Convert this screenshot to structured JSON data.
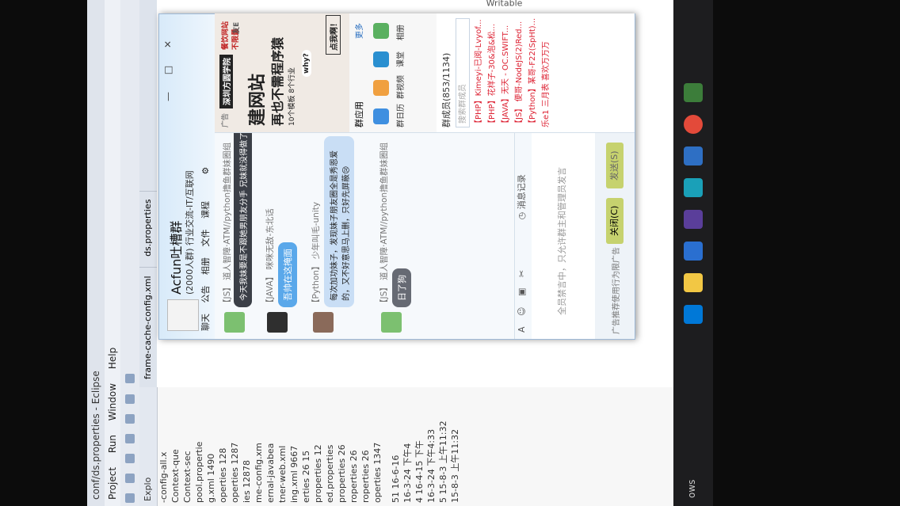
{
  "eclipse": {
    "title": "conf/ds.properties - Eclipse",
    "menu": [
      "Project",
      "Run",
      "Window",
      "Help"
    ],
    "explorer_tab": "Explo",
    "explorer_rows": [
      "-config-all.x",
      "Context-que",
      "Context-sec",
      "pool.propertie",
      "g.xml 1490",
      "operties 128",
      "operties 1287",
      "ies 12878",
      "me-config.xm",
      "ernal-javabea",
      "tner-web.xml",
      "ing.xml 9667",
      "erties 26 15",
      "properties 12",
      "ed.properties",
      "properties 26",
      "roperties 26",
      "roperties 26",
      "operties 1347"
    ],
    "editor_tabs": [
      "frame-cache-config.xml",
      "ds.properties"
    ],
    "history_rows": [
      "51 16-6-16",
      "16-3-24 下午4",
      "4 16-4-15 下午",
      "16-3-24 下午4:33",
      "5 15-8-3 上午11:32",
      "15-8-3 上午11:32"
    ],
    "side_label": "Writable",
    "taskbar_label": "ows"
  },
  "qq": {
    "group_name": "Acfun吐槽群",
    "group_sub": "(2000人群) 行业交流-IT/互联网",
    "win_buttons": [
      "—",
      "□",
      "✕"
    ],
    "tabs": [
      "聊天",
      "公告",
      "相册",
      "文件",
      "课程"
    ],
    "messages": [
      {
        "name": "【JS】 道人智障·ATM//python撸鱼群妹圈组",
        "text": "今天我妹要是不跟她男朋友分手 兄妹就没得做了",
        "style": "dark"
      },
      {
        "name": "【JAVA】 咪咪无敌-东北话",
        "text": "吾帅在这掩面",
        "style": "blue"
      },
      {
        "name": "【Python】 少年叫毛-unity",
        "text": "每次加功妹子，发现妹子朋友圈全是秀恩爱的，又不好意思马上删，只好先屏蔽😢",
        "style": "light"
      },
      {
        "name": "【JS】 道人智障·ATM//python撸鱼群妹圈组",
        "text": "日了狗",
        "style": "gray"
      }
    ],
    "history_link": "消息记录",
    "input_hint": "全员禁言中，只允许群主和管理员发言",
    "send_label": "发送(S)",
    "close_label": "关闭(C)",
    "footer_ad": "广告推荐使用行为限广告",
    "ad": {
      "tag": "广告",
      "brand": "深圳方圆学院",
      "line1": "建网站",
      "line2": "再也不需程序猿",
      "line3": "10个模板 8个行业",
      "cta": "点我啊！",
      "badge": "餐饮网站 不限量",
      "bubble": "why?",
      "logo": "友E"
    },
    "apps_title": "群应用",
    "apps_more": "更多",
    "apps": [
      "群日历",
      "群视频",
      "课堂",
      "相册"
    ],
    "members_title": "群成员(853/1134)",
    "search_placeholder": "搜索群成员",
    "members": [
      "【PHP】Kimeyi-已阅-Lvyof...",
      "【PHP】花样子-30&泡&松...",
      "【JAVA】无天 - OC.SWIFT...",
      "【JS】 便哥-NodeJS(2)Red...",
      "【Python】某哥-F22(SpHt)...",
      "乐e1 三月表 喜欢万万万"
    ]
  },
  "colors": {
    "qq_header": "#d8eaf9",
    "bubble_dark": "#3b3f47",
    "bubble_blue": "#5aa8ea",
    "bubble_light": "#c9def5",
    "member_red": "#d23030",
    "send_button": "#c6d26e"
  }
}
